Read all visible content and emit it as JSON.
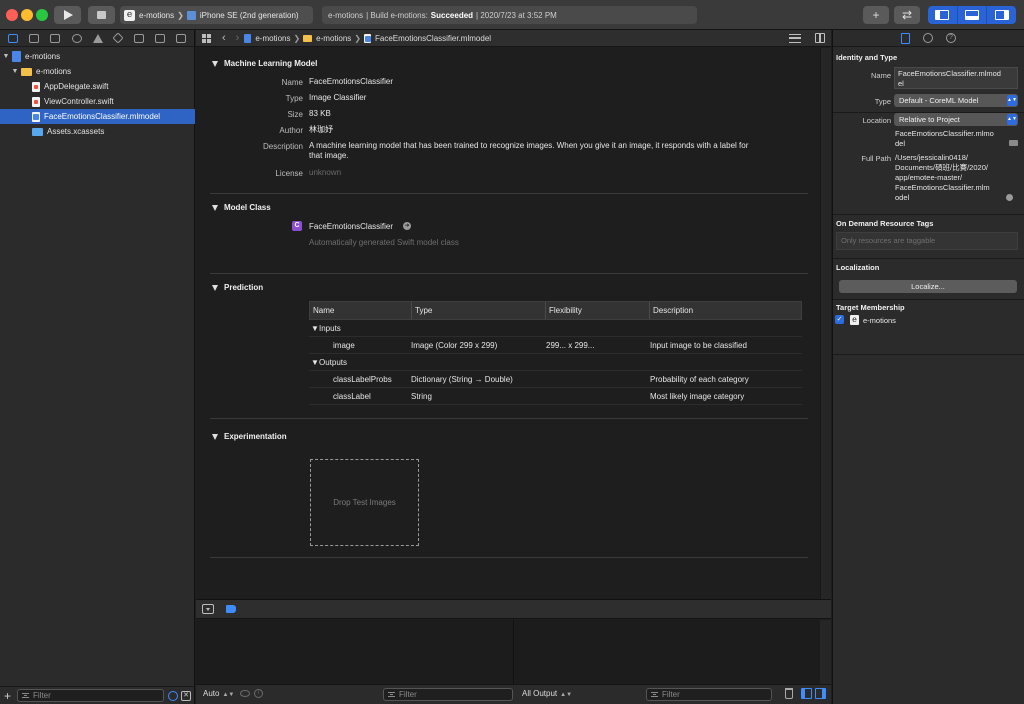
{
  "toolbar": {
    "scheme": "e-motions",
    "device": "iPhone SE (2nd generation)",
    "activity_project": "e-motions",
    "activity_prefix": "| Build e-motions:",
    "activity_status": "Succeeded",
    "activity_time": "| 2020/7/23 at 3:52 PM"
  },
  "navigator": {
    "items": [
      {
        "label": "e-motions"
      },
      {
        "label": "e-motions"
      },
      {
        "label": "AppDelegate.swift"
      },
      {
        "label": "ViewController.swift"
      },
      {
        "label": "FaceEmotionsClassifier.mlmodel"
      },
      {
        "label": "Assets.xcassets"
      }
    ],
    "filter_placeholder": "Filter"
  },
  "jumpbar": {
    "crumbs": [
      "e-motions",
      "e-motions",
      "FaceEmotionsClassifier.mlmodel"
    ]
  },
  "model": {
    "ml_section_title": "Machine Learning Model",
    "name_label": "Name",
    "name_value": "FaceEmotionsClassifier",
    "type_label": "Type",
    "type_value": "Image Classifier",
    "size_label": "Size",
    "size_value": "83 KB",
    "author_label": "Author",
    "author_value": "林珈妤",
    "description_label": "Description",
    "description_line1": "A machine learning model that has been trained to recognize images. When you give it an image, it responds with a label for",
    "description_line2": "that image.",
    "license_label": "License",
    "license_value": "unknown",
    "class_section_title": "Model Class",
    "class_badge": "C",
    "class_name": "FaceEmotionsClassifier",
    "class_sub": "Automatically generated Swift model class",
    "prediction_section_title": "Prediction",
    "experimentation_section_title": "Experimentation",
    "drop_zone": "Drop Test Images"
  },
  "prediction_table": {
    "headers": [
      "Name",
      "Type",
      "Flexibility",
      "Description"
    ],
    "inputs_group": "Inputs",
    "outputs_group": "Outputs",
    "rows": [
      {
        "name": "image",
        "type": "Image (Color 299 x 299)",
        "flexibility": "299... x 299...",
        "description": "Input image to be classified"
      },
      {
        "name": "classLabelProbs",
        "type": "Dictionary (String → Double)",
        "flexibility": "",
        "description": "Probability of each category"
      },
      {
        "name": "classLabel",
        "type": "String",
        "flexibility": "",
        "description": "Most likely image category"
      }
    ]
  },
  "debug": {
    "auto_label": "Auto",
    "all_output_label": "All Output",
    "filter_placeholder": "Filter"
  },
  "inspector": {
    "identity_title": "Identity and Type",
    "name_label": "Name",
    "name_value_line1": "FaceEmotionsClassifier.mlmod",
    "name_value_line2": "el",
    "type_label": "Type",
    "type_value": "Default - CoreML Model",
    "location_label": "Location",
    "location_value": "Relative to Project",
    "location_file_line1": "FaceEmotionsClassifier.mlmo",
    "location_file_line2": "del",
    "full_path_label": "Full Path",
    "full_path_lines": [
      "/Users/jessicalin0418/",
      "Documents/碩班/比賽/2020/",
      "app/emotee-master/",
      "FaceEmotionsClassifier.mlm",
      "odel"
    ],
    "tags_title": "On Demand Resource Tags",
    "tags_placeholder": "Only resources are taggable",
    "localization_title": "Localization",
    "localize_button": "Localize...",
    "target_title": "Target Membership",
    "target_icon": "e",
    "target_name": "e-motions"
  },
  "icons": {
    "app_icon": "e"
  }
}
